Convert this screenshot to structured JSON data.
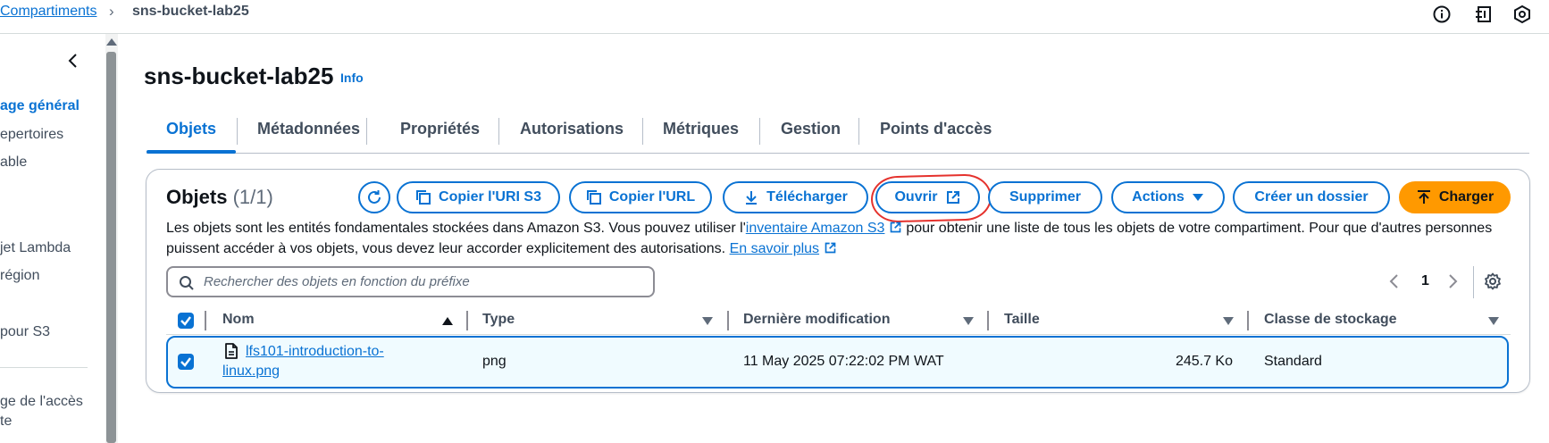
{
  "breadcrumb": {
    "parent": "Compartiments",
    "separator": "›",
    "current": "sns-bucket-lab25"
  },
  "top_icons": [
    "info-circle-icon",
    "notifications-panel-icon",
    "settings-hexagon-icon"
  ],
  "sidebar": {
    "items": [
      "age général",
      "epertoires",
      "able",
      "jet Lambda",
      "région",
      "pour S3",
      "ge de l'accès",
      "te"
    ],
    "active_index": 0
  },
  "header": {
    "title": "sns-bucket-lab25",
    "info": "Info"
  },
  "tabs": [
    "Objets",
    "Métadonnées",
    "Propriétés",
    "Autorisations",
    "Métriques",
    "Gestion",
    "Points d'accès"
  ],
  "panel": {
    "title": "Objets",
    "count": "(1/1)",
    "buttons": {
      "copy_uri": "Copier l'URI S3",
      "copy_url": "Copier l'URL",
      "download": "Télécharger",
      "open": "Ouvrir",
      "delete": "Supprimer",
      "actions": "Actions",
      "create_folder": "Créer un dossier",
      "upload": "Charger"
    },
    "description": {
      "part1": "Les objets sont les entités fondamentales stockées dans Amazon S3. Vous pouvez utiliser l'",
      "link1": "inventaire Amazon S3",
      "part2": " pour obtenir une liste de tous les objets de votre compartiment. Pour que d'autres personnes puissent accéder à vos objets, vous devez leur accorder explicitement des autorisations. ",
      "link2": "En savoir plus"
    },
    "search_placeholder": "Rechercher des objets en fonction du préfixe",
    "page": "1"
  },
  "table": {
    "columns": [
      "Nom",
      "Type",
      "Dernière modification",
      "Taille",
      "Classe de stockage"
    ],
    "rows": [
      {
        "name": "lfs101-introduction-to-linux.png",
        "type": "png",
        "modified": "11 May 2025 07:22:02 PM WAT",
        "size": "245.7 Ko",
        "storage_class": "Standard",
        "selected": true
      }
    ]
  },
  "colors": {
    "accent": "#0972d3",
    "primary_button": "#ff9900",
    "annotation": "#e5322d",
    "selected_row_bg": "#f0fbff"
  }
}
